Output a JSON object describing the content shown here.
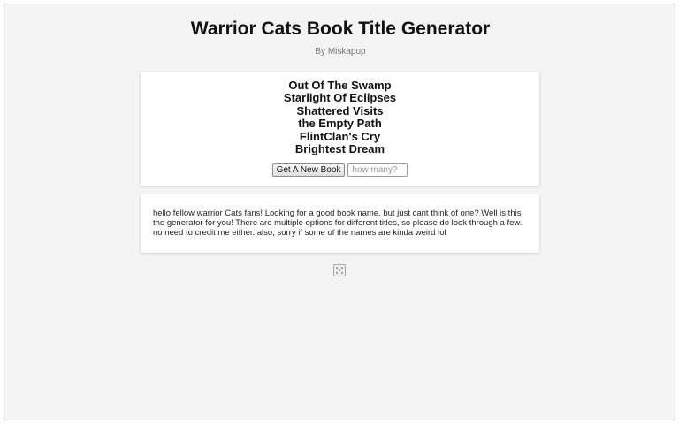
{
  "header": {
    "title": "Warrior Cats Book Title Generator",
    "byline": "By Miskapup"
  },
  "generator": {
    "names": [
      "Out Of The Swamp",
      "Starlight Of Eclipses",
      "Shattered Visits",
      "the Empty Path",
      "FlintClan's Cry",
      "Brightest Dream"
    ],
    "button_label": "Get A New Book",
    "quantity_placeholder": "how many?"
  },
  "description": {
    "text": "hello fellow warrior Cats fans! Looking for a good book name, but just cant think of one? Well is this the generator for you! There are multiple options for different titles, so please do look through a few. no need to credit me either. also, sorry if some of the names are kinda weird lol"
  },
  "footer": {
    "icon": "dice-icon"
  }
}
